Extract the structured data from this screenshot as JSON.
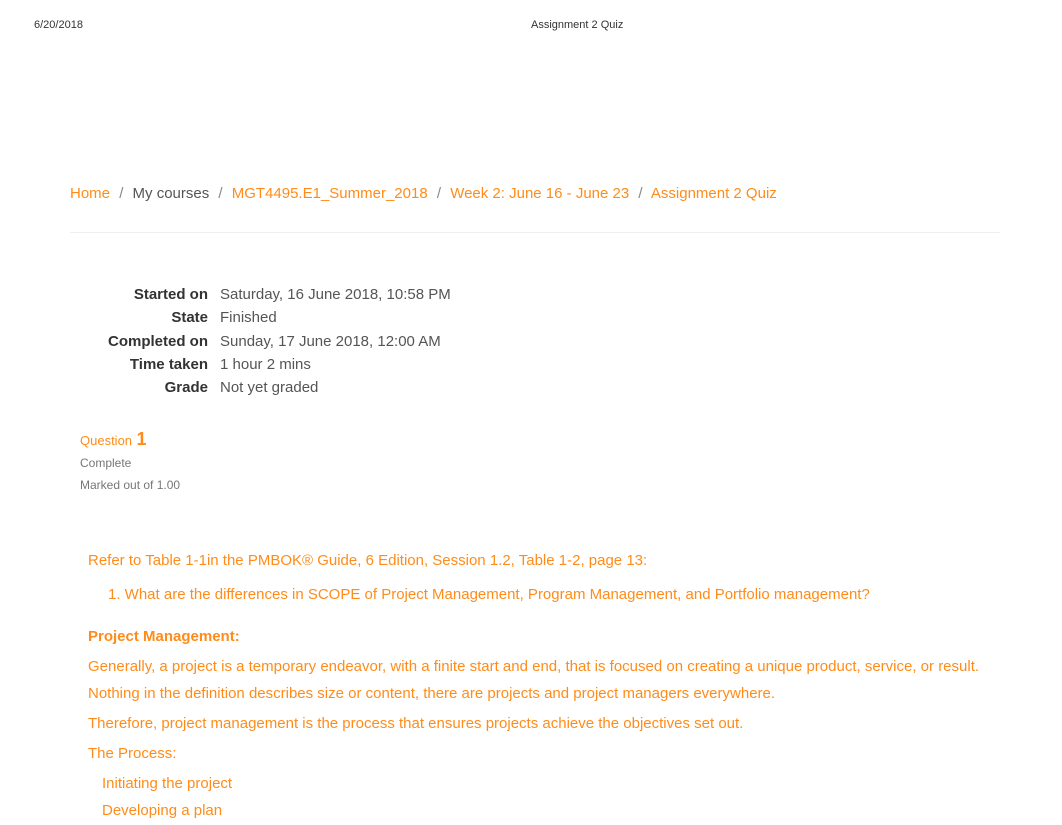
{
  "header": {
    "date": "6/20/2018",
    "title": "Assignment 2 Quiz"
  },
  "breadcrumb": {
    "home": "Home",
    "mycourses": "My courses",
    "course": "MGT4495.E1_Summer_2018",
    "week": "Week 2: June 16 - June 23",
    "current": "Assignment 2 Quiz"
  },
  "info": {
    "started_label": "Started on",
    "started_value": "Saturday, 16 June 2018, 10:58 PM",
    "state_label": "State",
    "state_value": "Finished",
    "completed_label": "Completed on",
    "completed_value": "Sunday, 17 June 2018, 12:00 AM",
    "timetaken_label": "Time taken",
    "timetaken_value": "1 hour 2 mins",
    "grade_label": "Grade",
    "grade_value": "Not yet graded"
  },
  "question": {
    "label": "Question",
    "number": "1",
    "status": "Complete",
    "marks": "Marked out of 1.00",
    "prompt_intro": "Refer to Table 1-1in the PMBOK® Guide, 6   Edition, Session 1.2, Table 1-2, page 13:",
    "prompt_q1": "1. What are the differences in SCOPE of Project Management, Program Management, and Portfolio management?",
    "pm_heading": "Project Management:",
    "pm_para1": "Generally, a project is a temporary endeavor, with a finite start and end, that is focused on creating a unique product, service, or result. Nothing in the definition describes size or content, there are projects and project managers everywhere.",
    "pm_para2": "Therefore, project management is the process that ensures projects achieve the objectives set out.",
    "process_label": "The Process:",
    "process_item1": "Initiating the project",
    "process_item2": "Developing a plan"
  }
}
